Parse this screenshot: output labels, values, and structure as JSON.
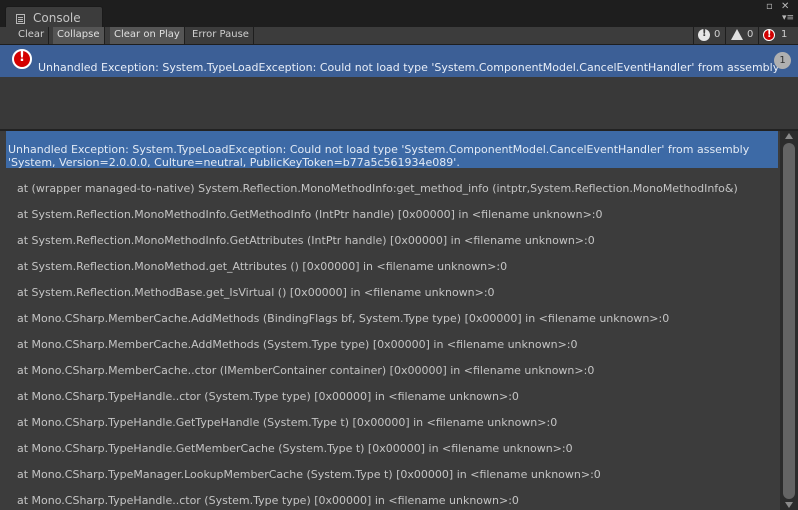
{
  "window": {
    "tab_title": "Console",
    "tab_icon": "console-icon",
    "menu_icon": "window-menu-icon"
  },
  "toolbar": {
    "buttons": [
      {
        "label": "Clear",
        "active": false
      },
      {
        "label": "Collapse",
        "active": true
      },
      {
        "label": "Clear on Play",
        "active": true
      },
      {
        "label": "Error Pause",
        "active": false
      }
    ],
    "counters": {
      "info": "0",
      "warnings": "0",
      "errors": "1"
    }
  },
  "log_entries": [
    {
      "icon": "error-icon",
      "text": "Unhandled Exception: System.TypeLoadException: Could not load type 'System.ComponentModel.CancelEventHandler' from assembly",
      "count": "1"
    }
  ],
  "detail": {
    "header_lines": [
      "Unhandled Exception: System.TypeLoadException: Could not load type 'System.ComponentModel.CancelEventHandler' from assembly",
      "'System, Version=2.0.0.0, Culture=neutral, PublicKeyToken=b77a5c561934e089'."
    ],
    "stack": [
      "at (wrapper managed-to-native) System.Reflection.MonoMethodInfo:get_method_info (intptr,System.Reflection.MonoMethodInfo&)",
      "at System.Reflection.MonoMethodInfo.GetMethodInfo (IntPtr handle) [0x00000] in <filename unknown>:0",
      "at System.Reflection.MonoMethodInfo.GetAttributes (IntPtr handle) [0x00000] in <filename unknown>:0",
      "at System.Reflection.MonoMethod.get_Attributes () [0x00000] in <filename unknown>:0",
      "at System.Reflection.MethodBase.get_IsVirtual () [0x00000] in <filename unknown>:0",
      "at Mono.CSharp.MemberCache.AddMethods (BindingFlags bf, System.Type type) [0x00000] in <filename unknown>:0",
      "at Mono.CSharp.MemberCache.AddMethods (System.Type type) [0x00000] in <filename unknown>:0",
      "at Mono.CSharp.MemberCache..ctor (IMemberContainer container) [0x00000] in <filename unknown>:0",
      "at Mono.CSharp.TypeHandle..ctor (System.Type type) [0x00000] in <filename unknown>:0",
      "at Mono.CSharp.TypeHandle.GetTypeHandle (System.Type t) [0x00000] in <filename unknown>:0",
      "at Mono.CSharp.TypeHandle.GetMemberCache (System.Type t) [0x00000] in <filename unknown>:0",
      "at Mono.CSharp.TypeManager.LookupMemberCache (System.Type t) [0x00000] in <filename unknown>:0",
      "at Mono.CSharp.TypeHandle..ctor (System.Type type) [0x00000] in <filename unknown>:0"
    ]
  },
  "colors": {
    "selection": "#3d6aa6",
    "error": "#d10000",
    "panel": "#3c3c3c"
  }
}
